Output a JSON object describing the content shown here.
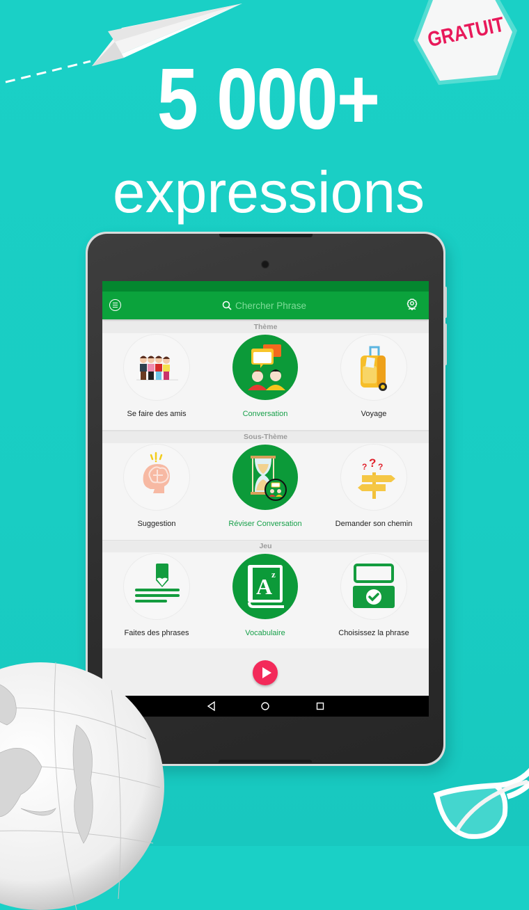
{
  "promo": {
    "headline": "5 000+",
    "subheadline": "expressions",
    "badge": "GRATUIT"
  },
  "colors": {
    "background": "#1ad0c6",
    "toolbar": "#0ba33c",
    "statusbar": "#04872f",
    "active_label": "#18a04a",
    "badge_text": "#e8195a",
    "play_button": "#f32a5a"
  },
  "app": {
    "toolbar": {
      "menu_icon": "menu-circle-icon",
      "search_icon": "search-icon",
      "search_placeholder": "Chercher Phrase",
      "settings_icon": "gear-flower-icon"
    },
    "sections": [
      {
        "title": "Thème",
        "items": [
          {
            "label": "Se faire des amis",
            "icon": "friends-group-icon",
            "active": false
          },
          {
            "label": "Conversation",
            "icon": "conversation-icon",
            "active": true
          },
          {
            "label": "Voyage",
            "icon": "suitcase-icon",
            "active": false
          }
        ]
      },
      {
        "title": "Sous-Thème",
        "items": [
          {
            "label": "Suggestion",
            "icon": "brain-idea-icon",
            "active": false
          },
          {
            "label": "Réviser Conversation",
            "icon": "hourglass-review-icon",
            "active": true
          },
          {
            "label": "Demander son chemin",
            "icon": "signpost-question-icon",
            "active": false
          }
        ]
      },
      {
        "title": "Jeu",
        "items": [
          {
            "label": "Faites des phrases",
            "icon": "pencil-lines-icon",
            "active": false
          },
          {
            "label": "Vocabulaire",
            "icon": "dictionary-az-icon",
            "active": true
          },
          {
            "label": "Choisissez la phrase",
            "icon": "choose-check-icon",
            "active": false
          }
        ]
      }
    ],
    "play_icon": "play-icon",
    "navbar": [
      "back-icon",
      "home-icon",
      "recents-icon"
    ]
  }
}
